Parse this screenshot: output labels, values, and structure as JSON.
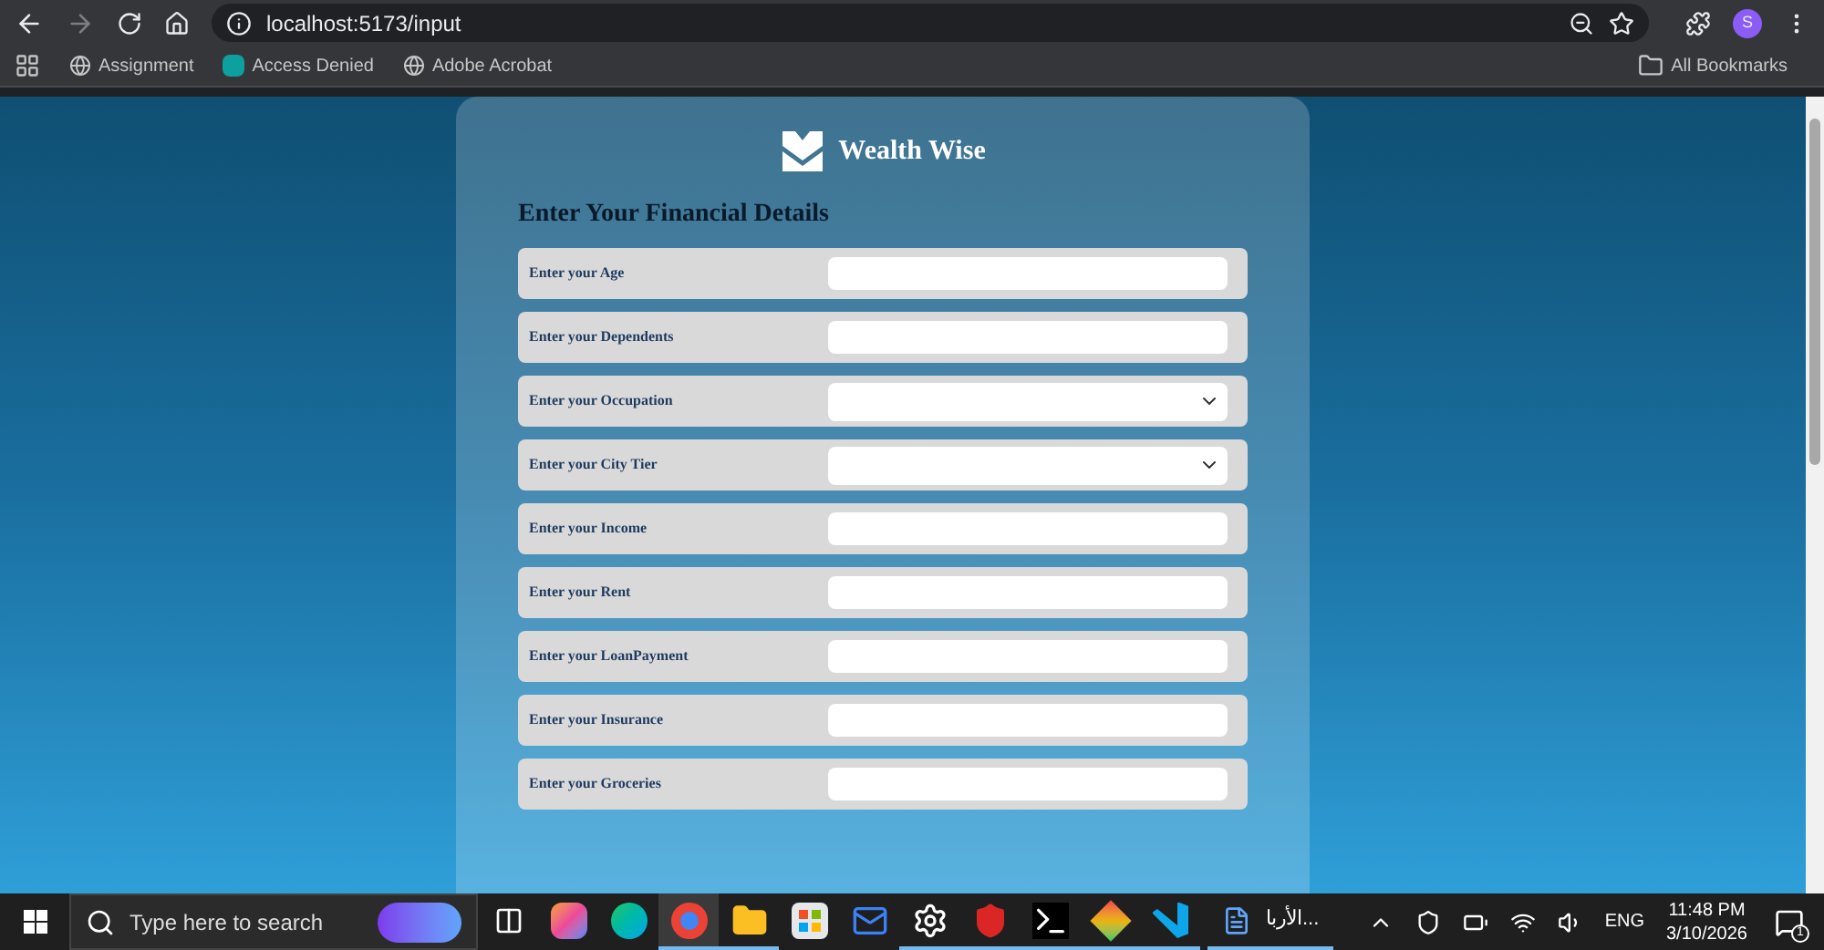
{
  "browser": {
    "back_disabled": false,
    "forward_disabled": true,
    "url": "localhost:5173/input",
    "profile_initial": "S",
    "bookmarks": [
      {
        "label": "Assignment",
        "kind": "globe"
      },
      {
        "label": "Access Denied",
        "kind": "site"
      },
      {
        "label": "Adobe Acrobat",
        "kind": "globe"
      }
    ],
    "all_bookmarks": "All Bookmarks"
  },
  "app": {
    "brand": "Wealth Wise",
    "heading": "Enter Your Financial Details",
    "fields": [
      {
        "label": "Enter your Age",
        "kind": "text"
      },
      {
        "label": "Enter your Dependents",
        "kind": "text"
      },
      {
        "label": "Enter your Occupation",
        "kind": "select"
      },
      {
        "label": "Enter your City Tier",
        "kind": "select"
      },
      {
        "label": "Enter your Income",
        "kind": "text"
      },
      {
        "label": "Enter your Rent",
        "kind": "text"
      },
      {
        "label": "Enter your LoanPayment",
        "kind": "text"
      },
      {
        "label": "Enter your Insurance",
        "kind": "text"
      },
      {
        "label": "Enter your Groceries",
        "kind": "text"
      }
    ]
  },
  "taskbar": {
    "search_placeholder": "Type here to search",
    "apps": [
      {
        "kind": "taskview",
        "running": false,
        "active": false
      },
      {
        "kind": "copilot",
        "running": false,
        "active": false
      },
      {
        "kind": "edge",
        "running": false,
        "active": false
      },
      {
        "kind": "chrome",
        "running": true,
        "active": true
      },
      {
        "kind": "files",
        "running": true,
        "active": false
      },
      {
        "kind": "store",
        "running": false,
        "active": false
      },
      {
        "kind": "mail",
        "running": false,
        "active": false
      },
      {
        "kind": "settings",
        "running": true,
        "active": false
      },
      {
        "kind": "shield",
        "running": true,
        "active": false
      },
      {
        "kind": "terminal",
        "running": true,
        "active": false
      },
      {
        "kind": "git",
        "running": true,
        "active": false
      },
      {
        "kind": "code",
        "running": true,
        "active": false
      }
    ],
    "document_title": "الأربا...",
    "language": "ENG",
    "time": "11:48 PM",
    "date": "3/10/2026",
    "notifications": "1"
  }
}
